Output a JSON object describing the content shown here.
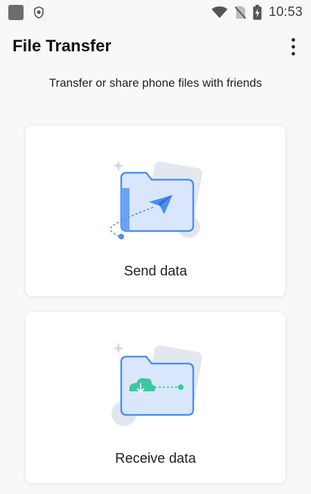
{
  "status_bar": {
    "time": "10:53",
    "icons": [
      "app-square-icon",
      "shield-icon",
      "wifi-icon",
      "no-sim-icon",
      "battery-charging-icon"
    ]
  },
  "header": {
    "title": "File Transfer",
    "more_icon": "more-vertical-icon"
  },
  "subtitle": "Transfer or share phone files with friends",
  "cards": [
    {
      "label": "Send data",
      "icon": "send-folder-icon"
    },
    {
      "label": "Receive data",
      "icon": "receive-folder-icon"
    }
  ],
  "colors": {
    "folder_blue": "#4a8ef0",
    "receive_green": "#3cc7a0",
    "background": "#f7f8f9"
  }
}
